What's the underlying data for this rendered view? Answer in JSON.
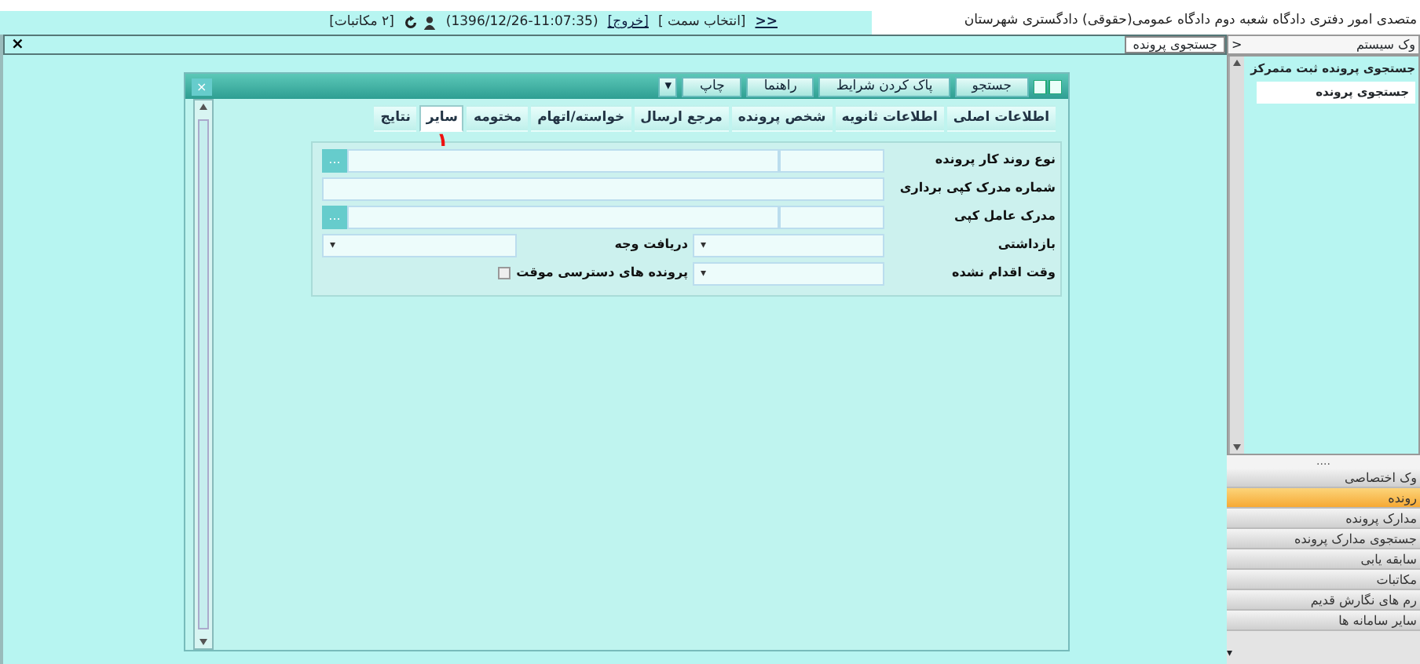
{
  "top_bar": {
    "user_title": "متصدی امور دفتری دادگاه شعبه دوم دادگاه عمومی(حقوقی) دادگستری شهرستان",
    "toggle": "<<",
    "select_role": "[انتخاب سمت ]",
    "logout": "[خروج]",
    "timestamp": "(1396/12/26-11:07:35)",
    "messages": "[۲ مکاتبات]"
  },
  "workspace": {
    "close": "×",
    "tabs": [
      {
        "label": "جستجوی پرونده",
        "selected": true
      }
    ]
  },
  "search_window": {
    "close": "×",
    "buttons": [
      {
        "label": "جستجو",
        "kind": "plain"
      },
      {
        "label": "پاک کردن شرایط",
        "kind": "plain"
      },
      {
        "label": "راهنما",
        "kind": "plain"
      },
      {
        "label": "چاپ",
        "kind": "split",
        "caret": "▾"
      }
    ],
    "tabs": [
      {
        "label": "اطلاعات اصلی",
        "selected": false
      },
      {
        "label": "اطلاعات ثانویه",
        "selected": false
      },
      {
        "label": "شخص پرونده",
        "selected": false
      },
      {
        "label": "مرجع ارسال",
        "selected": false
      },
      {
        "label": "خواسته/اتهام",
        "selected": false
      },
      {
        "label": "مختومه",
        "selected": false
      },
      {
        "label": "سایر",
        "selected": true
      },
      {
        "label": "نتایج",
        "selected": false
      }
    ],
    "annotation": "۱",
    "rows": [
      {
        "cells": [
          {
            "kind": "lookup",
            "label": "نوع روند کار پرونده",
            "button": "..."
          }
        ]
      },
      {
        "cells": [
          {
            "kind": "text",
            "label": "شماره مدرک کپی برداری"
          }
        ]
      },
      {
        "cells": [
          {
            "kind": "lookup",
            "label": "مدرک عامل کپی",
            "button": "..."
          }
        ]
      },
      {
        "cells": [
          {
            "kind": "select",
            "label": "بازداشتی",
            "caret": "▾"
          },
          {
            "kind": "select",
            "label": "دریافت وجه",
            "caret": "▾"
          }
        ]
      },
      {
        "cells": [
          {
            "kind": "select",
            "label": "وقت اقدام نشده",
            "caret": "▾"
          },
          {
            "kind": "checkbox",
            "label": "پرونده های دسترسی موقت",
            "checked": false
          }
        ]
      }
    ]
  },
  "sidebar": {
    "title": "وک سیستم",
    "collapse": "<",
    "tree": [
      {
        "label": "جستجوی پرونده ثبت متمرکز",
        "children": [
          {
            "label": "جستجوی پرونده",
            "selected": true
          }
        ]
      }
    ],
    "splitter": "....",
    "menu": [
      {
        "label": "وک اختصاصی",
        "selected": false
      },
      {
        "label": "رونده",
        "selected": true
      },
      {
        "label": "مدارک پرونده",
        "selected": false
      },
      {
        "label": "جستجوی مدارک پرونده",
        "selected": false
      },
      {
        "label": "سابقه یابی",
        "selected": false
      },
      {
        "label": "مکاتبات",
        "selected": false
      },
      {
        "label": "رم های نگارش قدیم",
        "selected": false
      },
      {
        "label": "سایر سامانه ها",
        "selected": false
      }
    ],
    "menu_scroll": "▾"
  }
}
